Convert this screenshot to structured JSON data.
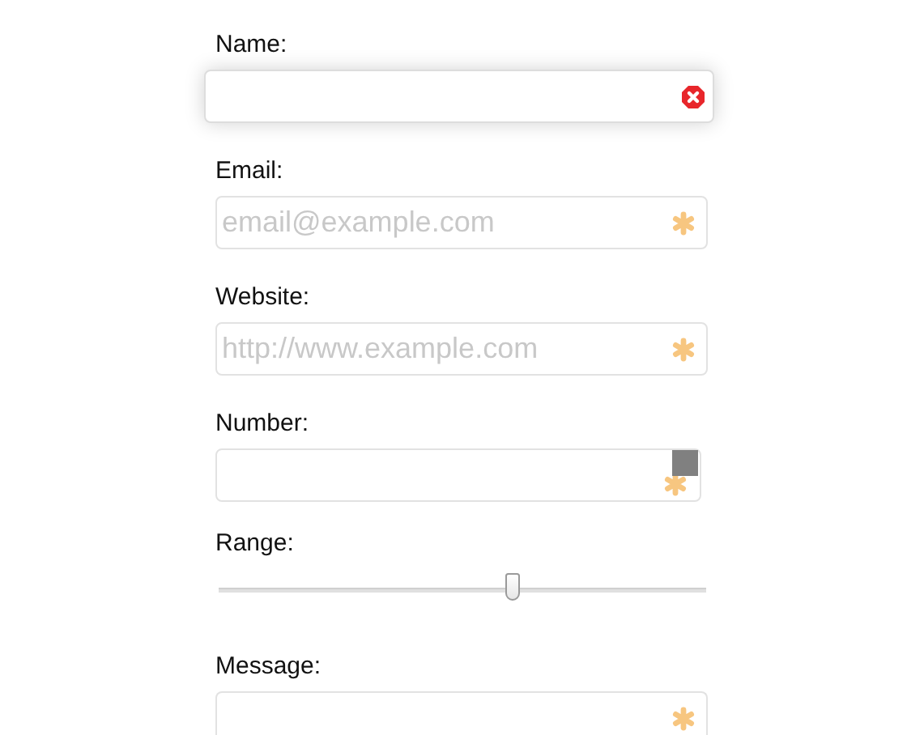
{
  "fields": [
    {
      "label": "Name:",
      "kind": "text",
      "invalid": true,
      "required": false,
      "focused": true
    },
    {
      "label": "Email:",
      "kind": "text",
      "placeholder": "email@example.com",
      "invalid": false,
      "required": true,
      "focused": false
    },
    {
      "label": "Website:",
      "kind": "text",
      "placeholder": "http://www.example.com",
      "invalid": false,
      "required": true,
      "focused": false
    },
    {
      "label": "Number:",
      "kind": "number",
      "invalid": false,
      "required": true,
      "focused": false
    },
    {
      "label": "Range:",
      "kind": "range",
      "level": 0.6
    },
    {
      "label": "Message:",
      "kind": "textarea",
      "invalid": false,
      "required": true,
      "focused": false
    }
  ]
}
